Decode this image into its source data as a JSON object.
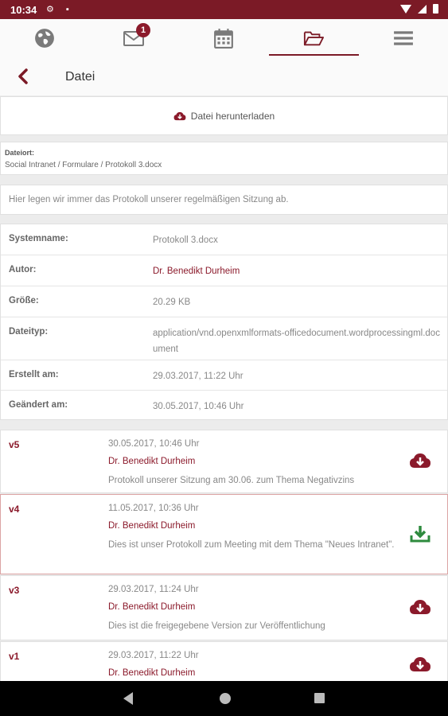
{
  "status_bar": {
    "time": "10:34"
  },
  "nav": {
    "items": [
      {
        "name": "globe-icon"
      },
      {
        "name": "mail-icon",
        "badge": "1"
      },
      {
        "name": "calendar-icon"
      },
      {
        "name": "folder-open-icon",
        "active": true
      },
      {
        "name": "menu-icon"
      }
    ],
    "accent": "#7b1a26"
  },
  "header": {
    "title": "Datei"
  },
  "download": {
    "label": "Datei herunterladen"
  },
  "location": {
    "label": "Dateiort:",
    "path": "Social Intranet / Formulare / Protokoll 3.docx"
  },
  "description": "Hier legen wir immer das Protokoll unserer regelmäßigen Sitzung ab.",
  "properties": [
    {
      "key": "Systemname:",
      "value": "Protokoll 3.docx"
    },
    {
      "key": "Autor:",
      "value": "Dr. Benedikt Durheim"
    },
    {
      "key": "Größe:",
      "value": "20.29 KB"
    },
    {
      "key": "Dateityp:",
      "value": "application/vnd.openxmlformats-officedocument.wordprocessingml.document"
    },
    {
      "key": "Erstellt am:",
      "value": "29.03.2017, 11:22 Uhr"
    },
    {
      "key": "Geändert am:",
      "value": "30.05.2017, 10:46 Uhr"
    }
  ],
  "versions": [
    {
      "tag": "v5",
      "date": "30.05.2017, 10:46 Uhr",
      "author": "Dr. Benedikt Durheim",
      "comment": "Protokoll unserer Sitzung am 30.06. zum Thema Negativzins",
      "icon": "cloud-download-icon"
    },
    {
      "tag": "v4",
      "date": "11.05.2017, 10:36 Uhr",
      "author": "Dr. Benedikt Durheim",
      "comment": "Dies ist unser Protokoll zum Meeting mit dem Thema \"Neues Intranet\".",
      "icon": "download-icon"
    },
    {
      "tag": "v3",
      "date": "29.03.2017, 11:24 Uhr",
      "author": "Dr. Benedikt Durheim",
      "comment": "Dies ist die freigegebene Version zur Veröffentlichung",
      "icon": "cloud-download-icon"
    },
    {
      "tag": "v1",
      "date": "29.03.2017, 11:22 Uhr",
      "author": "Dr. Benedikt Durheim",
      "comment": "",
      "icon": "cloud-download-icon"
    }
  ],
  "colors": {
    "brand": "#8b1a2b",
    "download_green": "#2e8b3e"
  }
}
